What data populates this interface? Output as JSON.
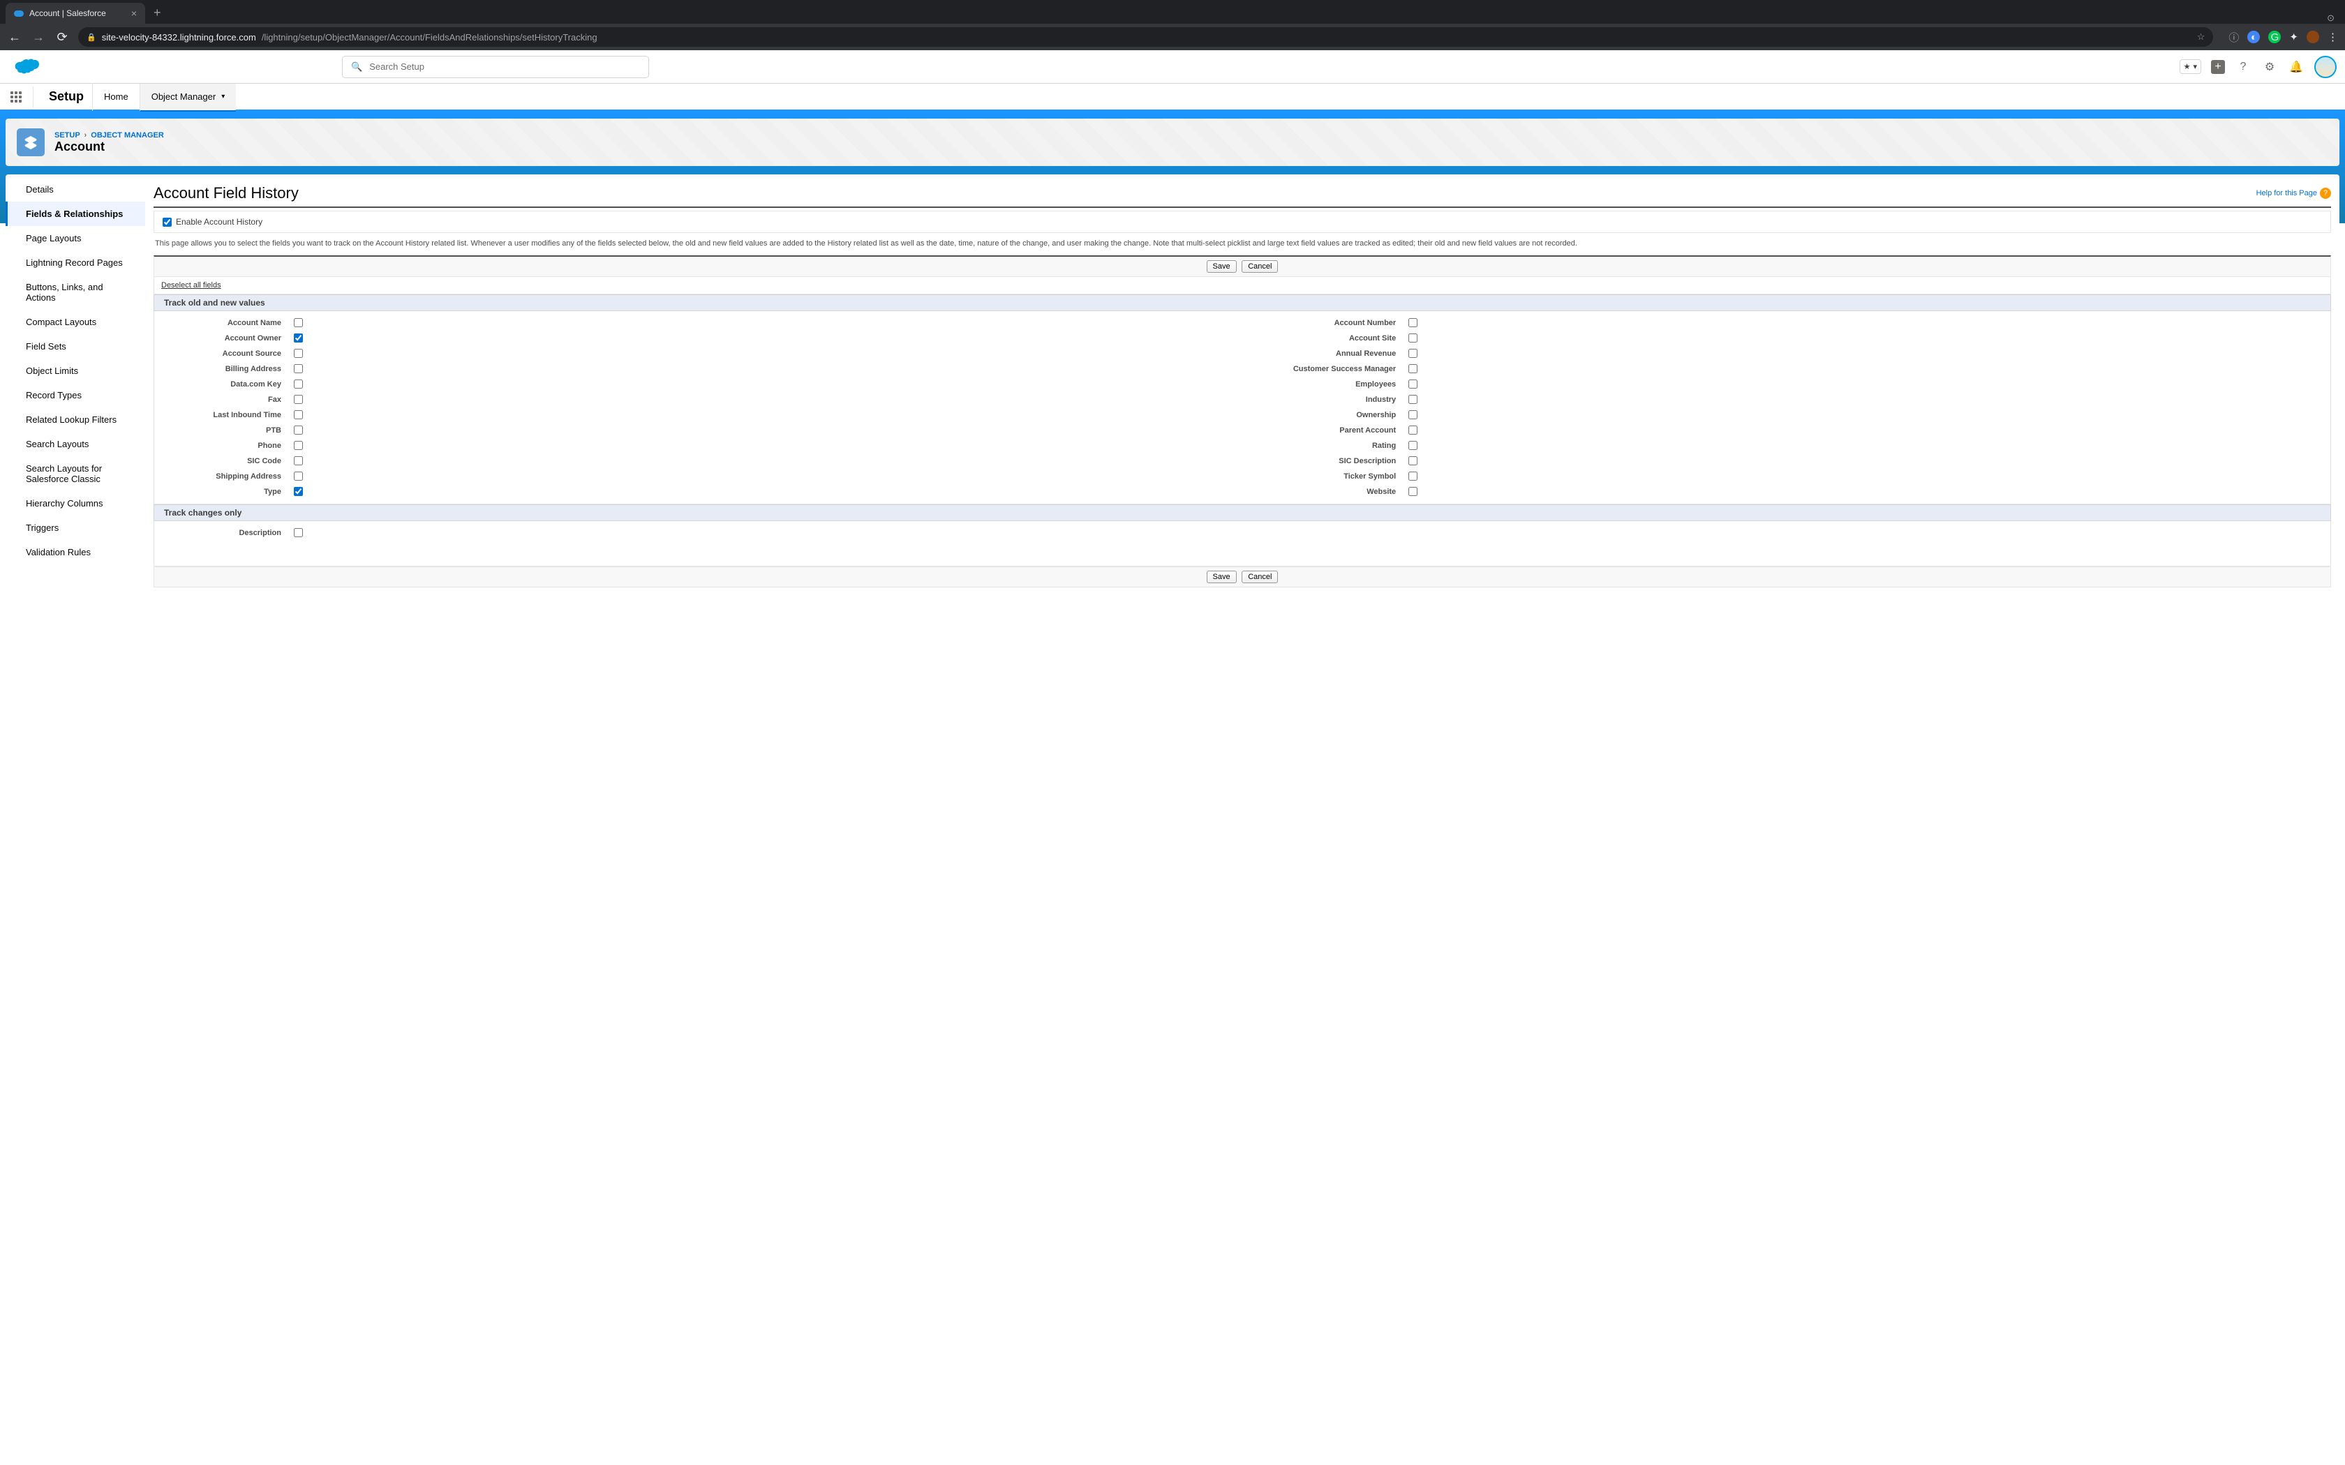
{
  "browser": {
    "tab_title": "Account | Salesforce",
    "url_host": "site-velocity-84332.lightning.force.com",
    "url_path": "/lightning/setup/ObjectManager/Account/FieldsAndRelationships/setHistoryTracking"
  },
  "header": {
    "search_placeholder": "Search Setup"
  },
  "setup_nav": {
    "title": "Setup",
    "tabs": [
      "Home",
      "Object Manager"
    ]
  },
  "hero": {
    "breadcrumb1": "SETUP",
    "breadcrumb2": "OBJECT MANAGER",
    "title": "Account"
  },
  "sidebar": {
    "items": [
      "Details",
      "Fields & Relationships",
      "Page Layouts",
      "Lightning Record Pages",
      "Buttons, Links, and Actions",
      "Compact Layouts",
      "Field Sets",
      "Object Limits",
      "Record Types",
      "Related Lookup Filters",
      "Search Layouts",
      "Search Layouts for Salesforce Classic",
      "Hierarchy Columns",
      "Triggers",
      "Validation Rules"
    ]
  },
  "main": {
    "title": "Account Field History",
    "help_label": "Help for this Page",
    "enable_label": "Enable Account History",
    "description": "This page allows you to select the fields you want to track on the Account History related list. Whenever a user modifies any of the fields selected below, the old and new field values are added to the History related list as well as the date, time, nature of the change, and user making the change. Note that multi-select picklist and large text field values are tracked as edited; their old and new field values are not recorded.",
    "save_label": "Save",
    "cancel_label": "Cancel",
    "deselect_label": "Deselect all fields",
    "section1_title": "Track old and new values",
    "section2_title": "Track changes only",
    "left_fields": [
      {
        "label": "Account Name",
        "checked": false
      },
      {
        "label": "Account Owner",
        "checked": true
      },
      {
        "label": "Account Source",
        "checked": false
      },
      {
        "label": "Billing Address",
        "checked": false
      },
      {
        "label": "Data.com Key",
        "checked": false
      },
      {
        "label": "Fax",
        "checked": false
      },
      {
        "label": "Last Inbound Time",
        "checked": false
      },
      {
        "label": "PTB",
        "checked": false
      },
      {
        "label": "Phone",
        "checked": false
      },
      {
        "label": "SIC Code",
        "checked": false
      },
      {
        "label": "Shipping Address",
        "checked": false
      },
      {
        "label": "Type",
        "checked": true
      }
    ],
    "right_fields": [
      {
        "label": "Account Number",
        "checked": false
      },
      {
        "label": "Account Site",
        "checked": false
      },
      {
        "label": "Annual Revenue",
        "checked": false
      },
      {
        "label": "Customer Success Manager",
        "checked": false
      },
      {
        "label": "Employees",
        "checked": false
      },
      {
        "label": "Industry",
        "checked": false
      },
      {
        "label": "Ownership",
        "checked": false
      },
      {
        "label": "Parent Account",
        "checked": false
      },
      {
        "label": "Rating",
        "checked": false
      },
      {
        "label": "SIC Description",
        "checked": false
      },
      {
        "label": "Ticker Symbol",
        "checked": false
      },
      {
        "label": "Website",
        "checked": false
      }
    ],
    "changes_only": [
      {
        "label": "Description",
        "checked": false
      }
    ]
  }
}
